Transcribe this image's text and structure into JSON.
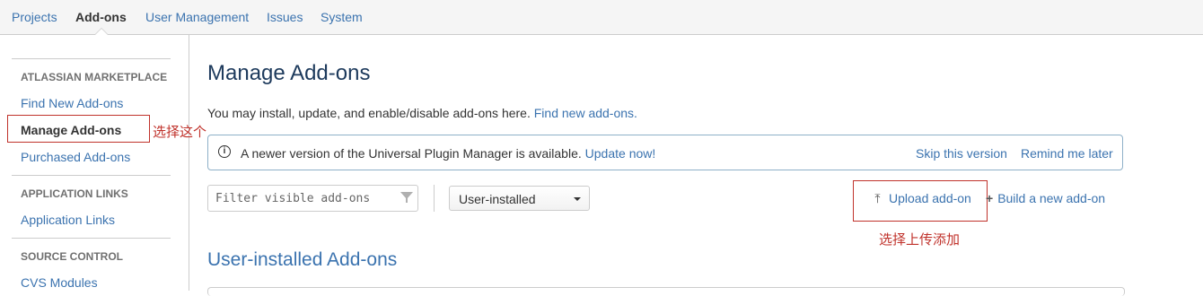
{
  "topnav": {
    "tabs": [
      {
        "label": "Projects"
      },
      {
        "label": "Add-ons"
      },
      {
        "label": "User Management"
      },
      {
        "label": "Issues"
      },
      {
        "label": "System"
      }
    ]
  },
  "sidebar": {
    "sections": [
      {
        "heading": "ATLASSIAN MARKETPLACE",
        "items": [
          "Find New Add-ons",
          "Manage Add-ons",
          "Purchased Add-ons"
        ]
      },
      {
        "heading": "APPLICATION LINKS",
        "items": [
          "Application Links"
        ]
      },
      {
        "heading": "SOURCE CONTROL",
        "items": [
          "CVS Modules"
        ]
      }
    ]
  },
  "annotations": {
    "manage_note": "选择这个",
    "upload_note": "选择上传添加",
    "color": "#c0322b"
  },
  "main": {
    "title": "Manage Add-ons",
    "intro_text": "You may install, update, and enable/disable add-ons here.",
    "intro_link": "Find new add-ons.",
    "notice": {
      "icon": "info-icon",
      "message": "A newer version of the Universal Plugin Manager is available.",
      "update_link": "Update now!",
      "skip_label": "Skip this version",
      "remind_label": "Remind me later"
    },
    "filter_placeholder": "Filter visible add-ons",
    "filter_selected": "User-installed",
    "upload_label": "Upload add-on",
    "build_label": "Build a new add-on",
    "section_title": "User-installed Add-ons"
  },
  "colors": {
    "link": "#3b73af",
    "heading": "#1d3a5c",
    "notice_border": "#8eb0c8"
  }
}
